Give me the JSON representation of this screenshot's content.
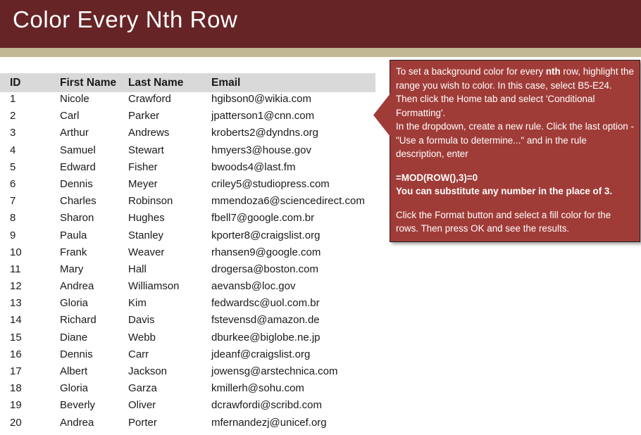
{
  "slide": {
    "title": "Color Every Nth Row",
    "banner_color": "#662426",
    "stripe_color": "#c2b894"
  },
  "table": {
    "header_background": "#d9d9d9",
    "columns": [
      "ID",
      "First Name",
      "Last Name",
      "Email"
    ],
    "rows": [
      {
        "id": "1",
        "first": "Nicole",
        "last": "Crawford",
        "email": "hgibson0@wikia.com"
      },
      {
        "id": "2",
        "first": "Carl",
        "last": "Parker",
        "email": "jpatterson1@cnn.com"
      },
      {
        "id": "3",
        "first": "Arthur",
        "last": "Andrews",
        "email": "kroberts2@dyndns.org"
      },
      {
        "id": "4",
        "first": "Samuel",
        "last": "Stewart",
        "email": "hmyers3@house.gov"
      },
      {
        "id": "5",
        "first": "Edward",
        "last": "Fisher",
        "email": "bwoods4@last.fm"
      },
      {
        "id": "6",
        "first": "Dennis",
        "last": "Meyer",
        "email": "criley5@studiopress.com"
      },
      {
        "id": "7",
        "first": "Charles",
        "last": "Robinson",
        "email": "mmendoza6@sciencedirect.com"
      },
      {
        "id": "8",
        "first": "Sharon",
        "last": "Hughes",
        "email": "fbell7@google.com.br"
      },
      {
        "id": "9",
        "first": "Paula",
        "last": "Stanley",
        "email": "kporter8@craigslist.org"
      },
      {
        "id": "10",
        "first": "Frank",
        "last": "Weaver",
        "email": "rhansen9@google.com"
      },
      {
        "id": "11",
        "first": "Mary",
        "last": "Hall",
        "email": "drogersa@boston.com"
      },
      {
        "id": "12",
        "first": "Andrea",
        "last": "Williamson",
        "email": "aevansb@loc.gov"
      },
      {
        "id": "13",
        "first": "Gloria",
        "last": "Kim",
        "email": "fedwardsc@uol.com.br"
      },
      {
        "id": "14",
        "first": "Richard",
        "last": "Davis",
        "email": "fstevensd@amazon.de"
      },
      {
        "id": "15",
        "first": "Diane",
        "last": "Webb",
        "email": "dburkee@biglobe.ne.jp"
      },
      {
        "id": "16",
        "first": "Dennis",
        "last": "Carr",
        "email": "jdeanf@craigslist.org"
      },
      {
        "id": "17",
        "first": "Albert",
        "last": "Jackson",
        "email": "jowensg@arstechnica.com"
      },
      {
        "id": "18",
        "first": "Gloria",
        "last": "Garza",
        "email": "kmillerh@sohu.com"
      },
      {
        "id": "19",
        "first": "Beverly",
        "last": "Oliver",
        "email": "dcrawfordi@scribd.com"
      },
      {
        "id": "20",
        "first": "Andrea",
        "last": "Porter",
        "email": "mfernandezj@unicef.org"
      }
    ]
  },
  "callout": {
    "background_color": "#a03c38",
    "para1_a": "To set a background color for every ",
    "para1_bold": "nth",
    "para1_b": " row, highlight the range you wish to color. In this case, select B5-E24. Then click the Home tab and select 'Conditional Formatting'.",
    "para2": "In the dropdown, create a new rule. Click the last option - \"Use a formula to determine...\" and in the rule description, enter",
    "formula": "=MOD(ROW(),3)=0",
    "formula_note": "You can substitute any number in the place of 3.",
    "para3": "Click the Format button and select a fill color for the rows. Then press OK and see the results."
  }
}
